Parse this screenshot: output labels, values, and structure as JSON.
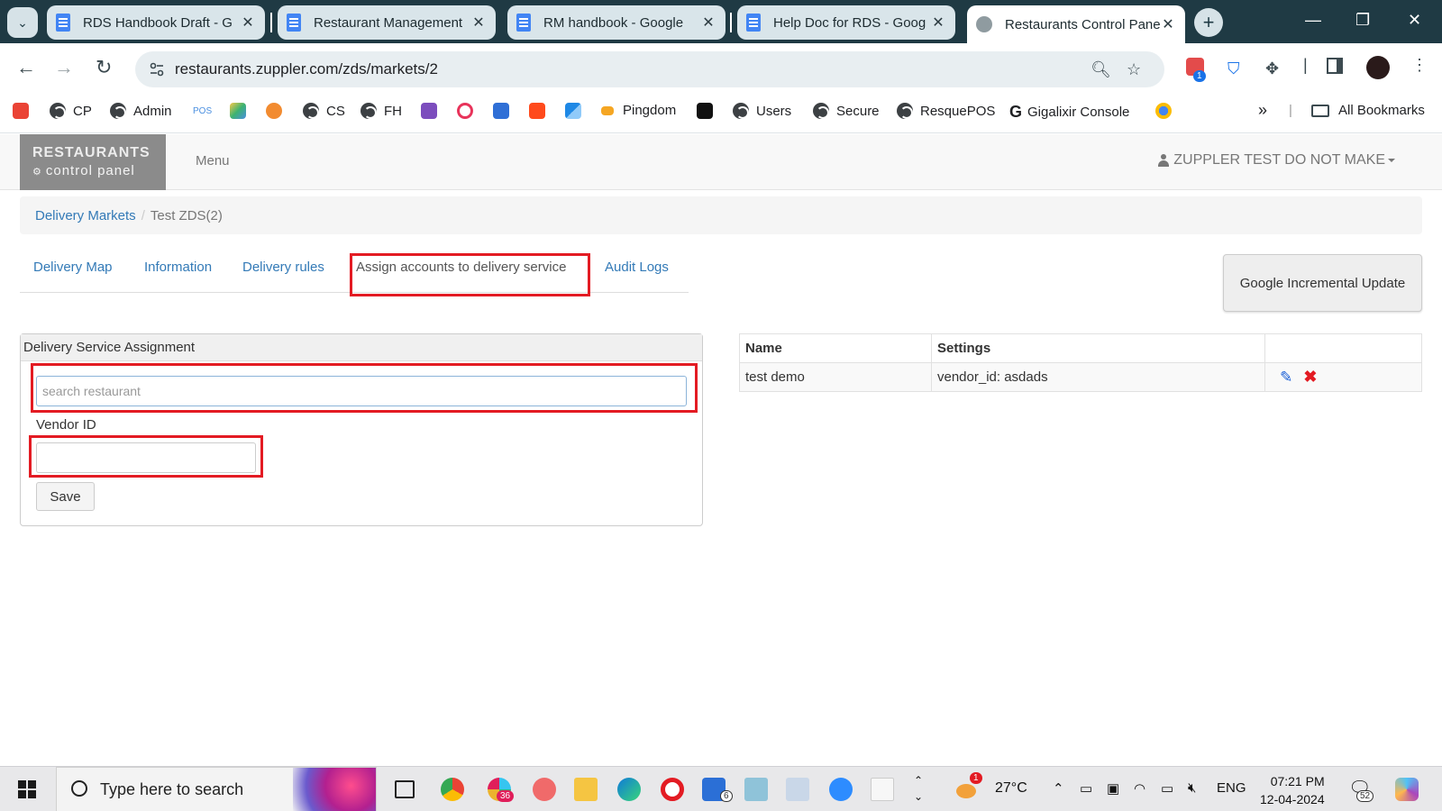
{
  "browser": {
    "tabs": [
      {
        "label": "RDS Handbook Draft - G"
      },
      {
        "label": "Restaurant Management"
      },
      {
        "label": "RM handbook - Google"
      },
      {
        "label": "Help Doc for RDS - Goog"
      },
      {
        "label": "Restaurants Control Pane"
      }
    ],
    "url": "restaurants.zuppler.com/zds/markets/2",
    "extension_badge": "1",
    "bookmarks": [
      {
        "label": "CP"
      },
      {
        "label": "Admin"
      },
      {
        "label": "CS"
      },
      {
        "label": "FH"
      },
      {
        "label": "Pingdom"
      },
      {
        "label": "Users"
      },
      {
        "label": "Secure"
      },
      {
        "label": "ResquePOS"
      },
      {
        "label": "Gigalixir Console"
      }
    ],
    "all_bookmarks": "All Bookmarks",
    "pos_bookmark_text": "POS"
  },
  "app": {
    "brand_top": "RESTAURANTS",
    "brand_bottom": "control panel",
    "menu": "Menu",
    "user": "ZUPPLER TEST DO NOT MAKE",
    "breadcrumb": {
      "link": "Delivery Markets",
      "current": "Test ZDS(2)"
    },
    "tabs": [
      {
        "label": "Delivery Map"
      },
      {
        "label": "Information"
      },
      {
        "label": "Delivery rules"
      },
      {
        "label": "Assign accounts to delivery service"
      },
      {
        "label": "Audit Logs"
      }
    ],
    "google_update_button": "Google Incremental Update",
    "assignment_panel": {
      "title": "Delivery Service Assignment",
      "search_placeholder": "search restaurant",
      "vendor_label": "Vendor ID",
      "vendor_value": "",
      "save": "Save"
    },
    "accounts_table": {
      "headers": [
        "Name",
        "Settings",
        ""
      ],
      "rows": [
        {
          "name": "test demo",
          "settings": "vendor_id: asdads"
        }
      ]
    }
  },
  "taskbar": {
    "search_placeholder": "Type here to search",
    "slack_badge": "36",
    "todo_badge": "6",
    "weather_alert": "1",
    "temperature": "27°C",
    "language": "ENG",
    "time": "07:21 PM",
    "date": "12-04-2024",
    "notifications": "52"
  },
  "colors": {
    "highlight_box": "#e31b23",
    "link": "#337ab7"
  }
}
